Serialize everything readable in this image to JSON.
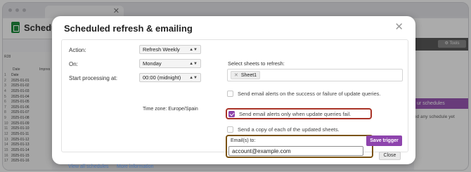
{
  "background": {
    "app_title": "Schedu",
    "cell_ref": "R28",
    "columns": [
      "Date",
      "Impres"
    ],
    "rows": [
      {
        "n": "1",
        "date": "Date"
      },
      {
        "n": "2",
        "date": "2025-01-01"
      },
      {
        "n": "3",
        "date": "2025-01-02"
      },
      {
        "n": "4",
        "date": "2025-01-03"
      },
      {
        "n": "5",
        "date": "2025-01-04"
      },
      {
        "n": "6",
        "date": "2025-01-05"
      },
      {
        "n": "7",
        "date": "2025-01-06"
      },
      {
        "n": "8",
        "date": "2025-01-07"
      },
      {
        "n": "9",
        "date": "2025-01-08"
      },
      {
        "n": "10",
        "date": "2025-01-09"
      },
      {
        "n": "11",
        "date": "2025-01-10"
      },
      {
        "n": "12",
        "date": "2025-01-11"
      },
      {
        "n": "13",
        "date": "2025-01-12"
      },
      {
        "n": "14",
        "date": "2025-01-13"
      },
      {
        "n": "15",
        "date": "2025-01-14"
      },
      {
        "n": "16",
        "date": "2025-01-15"
      },
      {
        "n": "17",
        "date": "2025-01-16"
      }
    ],
    "tools_label": "Tools",
    "side_button": "ur schedules",
    "side_text": "ed any schedule yet"
  },
  "dialog": {
    "title": "Scheduled refresh & emailing",
    "action_label": "Action:",
    "action_value": "Refresh Weekly",
    "on_label": "On:",
    "on_value": "Monday",
    "start_label": "Start processing at:",
    "start_value": "00:00 (midnight)",
    "timezone": "Time zone: Europe/Spain",
    "sheets_label": "Select sheets to refresh:",
    "sheet_chip": "Sheet1",
    "opt_success_failure": "Send email alerts on the success or failure of update queries.",
    "opt_only_fail": "Send email alerts only when update queries fail.",
    "opt_copy": "Send a copy of each of the updated sheets.",
    "emails_label": "Email(s) to:",
    "email_value": "account@example.com",
    "view_all_link": "View all schedules",
    "more_info_link": "More information",
    "save_button": "Save trigger",
    "close_button": "Close"
  },
  "colors": {
    "accent": "#8e44ad",
    "highlight_red": "#a93226",
    "highlight_brown": "#7a5212",
    "link": "#4a75b5"
  }
}
